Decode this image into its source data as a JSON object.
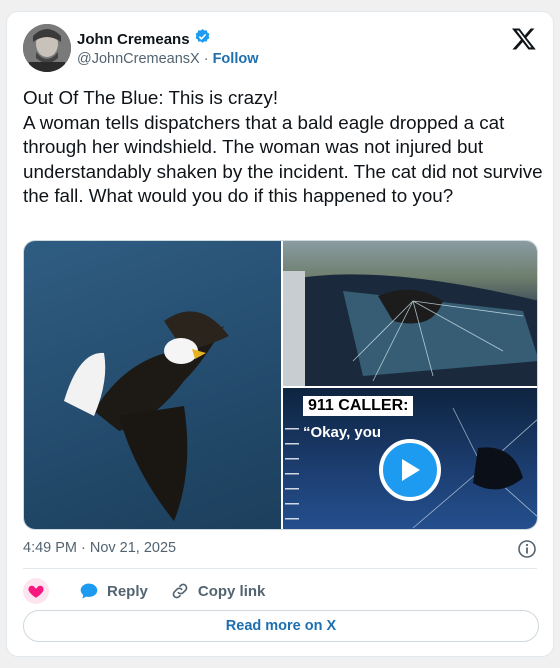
{
  "author": {
    "name": "John Cremeans",
    "handle": "@JohnCremeansX",
    "separator": "·",
    "follow_label": "Follow"
  },
  "tweet": {
    "text": "Out Of The Blue: This is crazy!\nA woman tells dispatchers that a bald eagle dropped a cat through her windshield. The woman was not injured but understandably shaken by the incident. The cat did not survive the fall. What would you do if this happened to you?"
  },
  "media": {
    "video_caption": "911 CALLER:",
    "video_quote": "“Okay, you"
  },
  "meta": {
    "time": "4:49 PM",
    "separator": "·",
    "date": "Nov 21, 2025"
  },
  "actions": {
    "reply_label": "Reply",
    "copy_label": "Copy link"
  },
  "footer": {
    "read_more_label": "Read more on X"
  },
  "colors": {
    "accent": "#1d9bf0",
    "link": "#1d6fb0",
    "like": "#f91880"
  }
}
